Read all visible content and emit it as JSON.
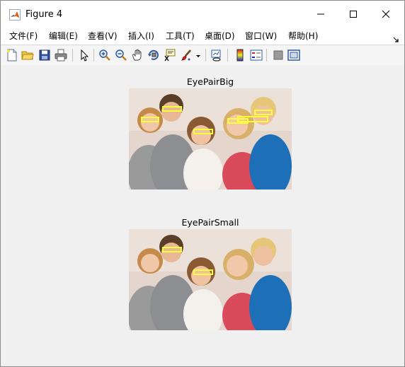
{
  "window": {
    "title": "Figure 4"
  },
  "menu": {
    "items": [
      "文件(F)",
      "编辑(E)",
      "查看(V)",
      "插入(I)",
      "工具(T)",
      "桌面(D)",
      "窗口(W)",
      "帮助(H)"
    ]
  },
  "toolbar": {
    "buttons": [
      "new-figure-icon",
      "open-file-icon",
      "save-icon",
      "print-icon",
      "edit-plot-icon",
      "zoom-in-icon",
      "zoom-out-icon",
      "pan-icon",
      "rotate-3d-icon",
      "data-cursor-icon",
      "brush-icon",
      "link-plot-icon",
      "colorbar-icon",
      "legend-icon",
      "hide-plot-tools-icon",
      "show-plot-tools-icon"
    ]
  },
  "plots": [
    {
      "title": "EyePairBig"
    },
    {
      "title": "EyePairSmall"
    }
  ],
  "colors": {
    "detection_box": "#ffff33",
    "canvas_bg": "#f0f0f0"
  }
}
